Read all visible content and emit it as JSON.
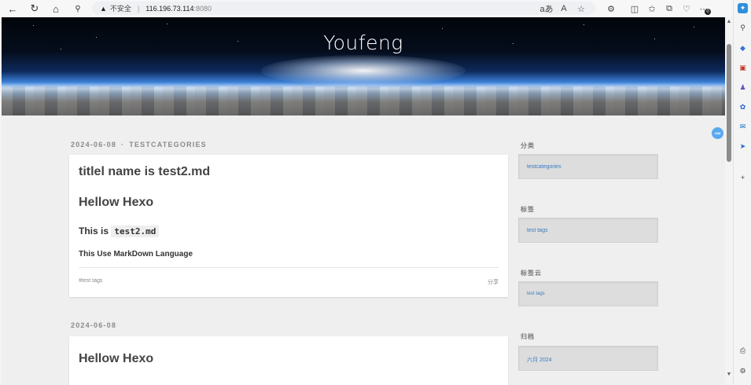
{
  "browser": {
    "insecure_label": "不安全",
    "url_host": "116.196.73.114",
    "url_port": ":8080",
    "notification_count": "0"
  },
  "site": {
    "title": "Youfeng"
  },
  "posts": [
    {
      "date": "2024-06-08",
      "category": "TESTCATEGORIES",
      "title": "titlel name is test2.md",
      "heading1": "Hellow Hexo",
      "heading3_prefix": "This is",
      "heading3_code": "test2.md",
      "heading4": "This Use MarkDown Language",
      "tag": "#test tags",
      "share": "分享"
    },
    {
      "date": "2024-06-08",
      "heading1": "Hellow Hexo"
    }
  ],
  "sidebar": {
    "categories": {
      "title": "分类",
      "item": "testcategories"
    },
    "tags": {
      "title": "标签",
      "item": "test tags"
    },
    "tagcloud": {
      "title": "标签云",
      "item": "test tags"
    },
    "archive": {
      "title": "归档",
      "item": "六月 2024"
    }
  },
  "float_badge": "20M",
  "colors": {
    "link": "#3a7bbf",
    "meta": "#8a8a8a",
    "accent": "#5aa8f0"
  }
}
